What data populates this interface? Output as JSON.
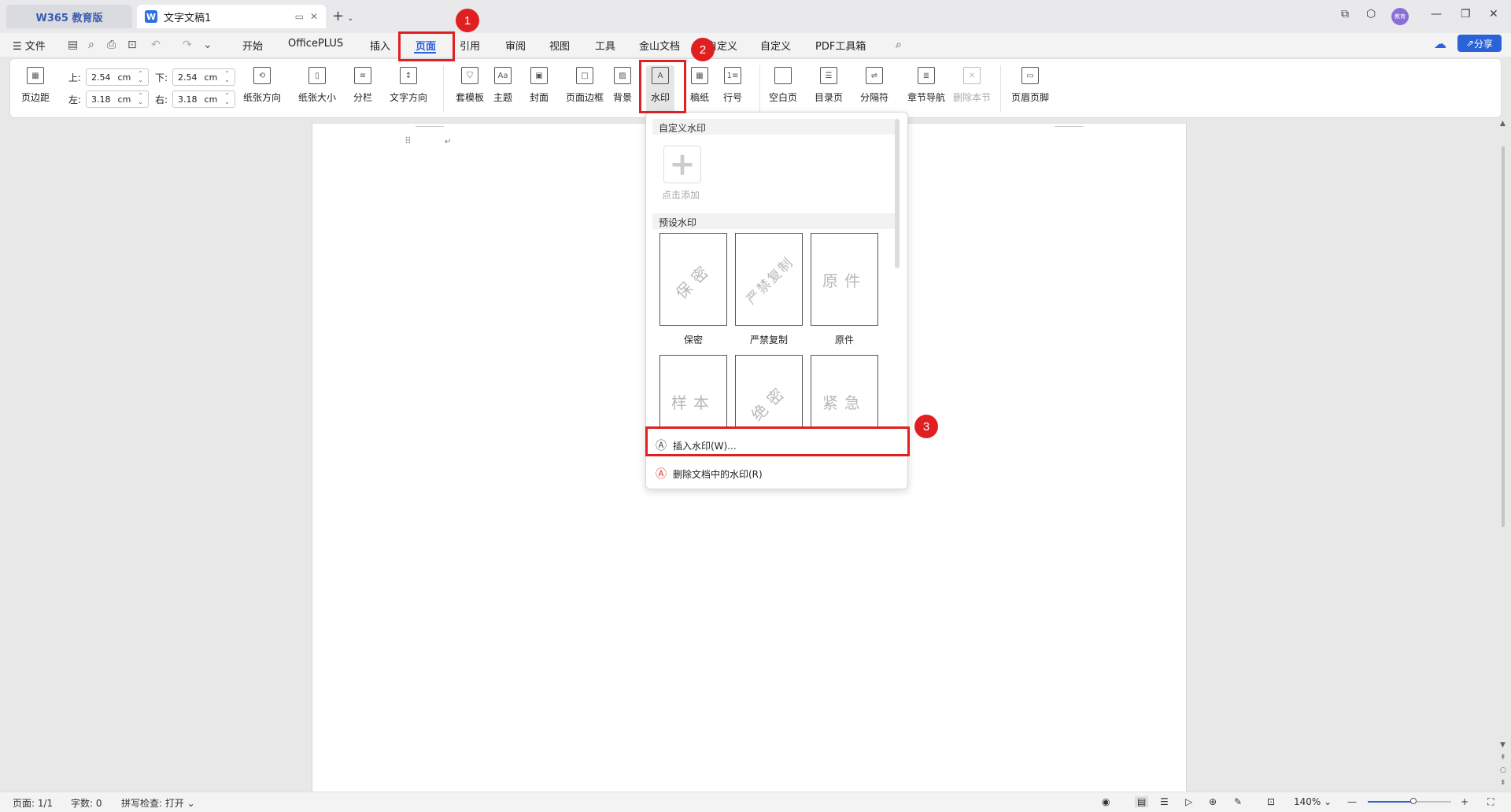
{
  "titlebar": {
    "app_tab": "W365 教育版",
    "doc_tab": "文字文稿1",
    "new_tab_icon": "plus-icon",
    "avatar_text": "教育"
  },
  "menubar": {
    "file": "文件",
    "tabs": [
      "开始",
      "OfficePLUS",
      "插入",
      "页面",
      "引用",
      "审阅",
      "视图",
      "工具",
      "金山文档",
      "自定义",
      "自定义",
      "PDF工具箱"
    ],
    "active_tab": "页面",
    "share": "分享"
  },
  "ribbon": {
    "margins": {
      "top_label": "上:",
      "top_value": "2.54",
      "top_unit": "cm",
      "bottom_label": "下:",
      "bottom_value": "2.54",
      "bottom_unit": "cm",
      "left_label": "左:",
      "left_value": "3.18",
      "left_unit": "cm",
      "right_label": "右:",
      "right_value": "3.18",
      "right_unit": "cm"
    },
    "buttons": {
      "margin": "页边距",
      "orientation": "纸张方向",
      "size": "纸张大小",
      "columns": "分栏",
      "text_direction": "文字方向",
      "template": "套模板",
      "theme": "主题",
      "cover": "封面",
      "page_border": "页面边框",
      "background": "背景",
      "watermark": "水印",
      "manuscript": "稿纸",
      "line_number": "行号",
      "blank_page": "空白页",
      "toc_page": "目录页",
      "separator": "分隔符",
      "chapter_nav": "章节导航",
      "delete_section": "删除本节",
      "header_footer": "页眉页脚"
    }
  },
  "watermark_menu": {
    "custom_header": "自定义水印",
    "add_label": "点击添加",
    "preset_header": "预设水印",
    "presets": [
      {
        "text": "保密",
        "caption": "保密"
      },
      {
        "text": "严禁复制",
        "caption": "严禁复制"
      },
      {
        "text": "原件",
        "caption": "原件"
      },
      {
        "text": "样本",
        "caption": ""
      },
      {
        "text": "绝密",
        "caption": ""
      },
      {
        "text": "紧急",
        "caption": ""
      }
    ],
    "insert": "插入水印(W)...",
    "remove": "删除文档中的水印(R)"
  },
  "annotations": {
    "badge1": "1",
    "badge2": "2",
    "badge3": "3",
    "highlight_color": "#e02020"
  },
  "statusbar": {
    "page": "页面: 1/1",
    "words": "字数: 0",
    "spell": "拼写检查: 打开",
    "zoom": "140%",
    "zoom_fraction": 0.55
  },
  "colors": {
    "accent": "#2a62d8"
  }
}
